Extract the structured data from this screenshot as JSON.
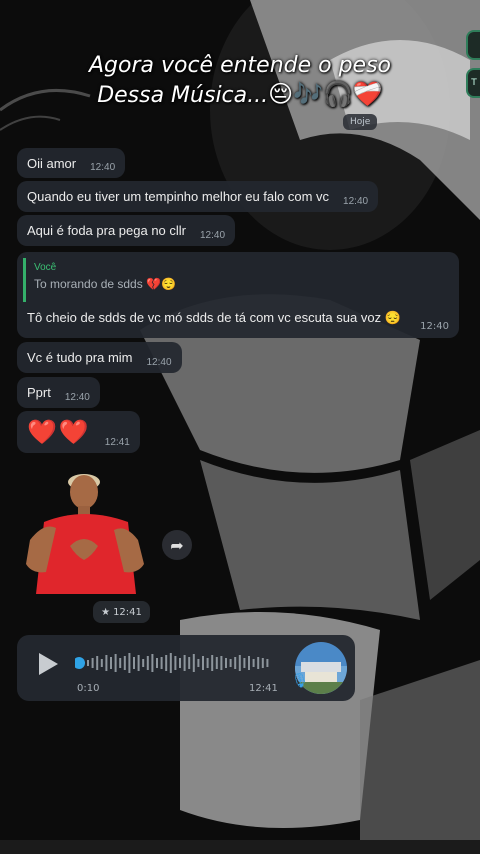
{
  "caption": {
    "line1": "Agora você entende o peso",
    "line2": "Dessa Música...",
    "emojis": "😔🎶🎧❤️‍🩹"
  },
  "right_tabs": [
    "",
    "T"
  ],
  "date_chip": "Hoje",
  "messages": [
    {
      "text": "Oii amor",
      "time": "12:40"
    },
    {
      "text": "Quando eu tiver um tempinho melhor eu falo com vc",
      "time": "12:40"
    },
    {
      "text": "Aqui é foda pra pega no cllr",
      "time": "12:40"
    },
    {
      "text": "Vc é tudo pra mim",
      "time": "12:40"
    },
    {
      "text": "Pprt",
      "time": "12:40"
    },
    {
      "text": "❤️❤️",
      "time": "12:41"
    }
  ],
  "reply": {
    "quoted_name": "Você",
    "quoted_text": "To morando de sdds 💔😌",
    "text": "Tô cheio de sdds de vc mó sdds de tá com vc escuta sua voz 😔",
    "time": "12:40"
  },
  "sticker": {
    "time": "12:41",
    "star": "★"
  },
  "voice": {
    "duration": "0:10",
    "time": "12:41",
    "progress": 0
  },
  "icons": {
    "play": "play-icon",
    "forward": "forward-icon",
    "mic": "mic-icon",
    "star": "star-icon"
  },
  "colors": {
    "accent_green": "#3bbf73",
    "bubble": "#24282f",
    "voice_dot": "#2fa3e6"
  }
}
